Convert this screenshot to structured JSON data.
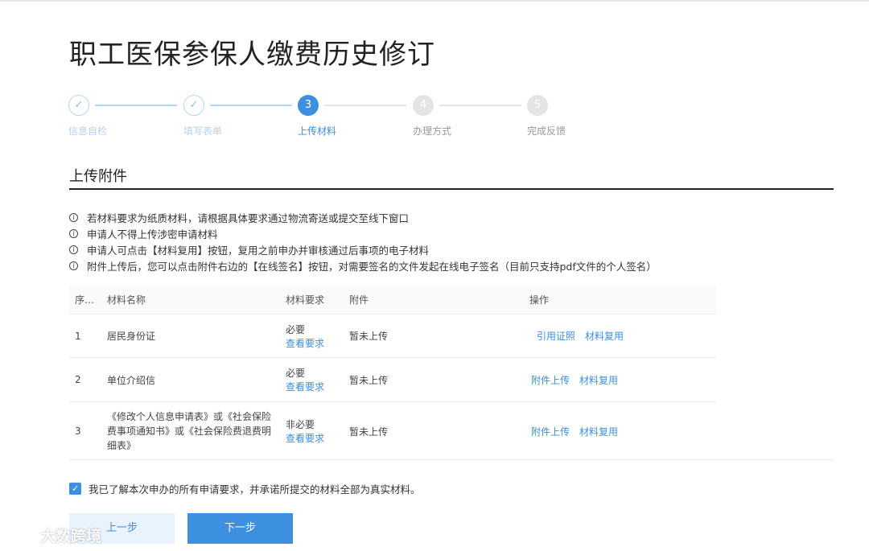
{
  "page": {
    "title": "职工医保参保人缴费历史修订"
  },
  "steps": [
    {
      "number": "✓",
      "label": "信息自检",
      "state": "done"
    },
    {
      "number": "✓",
      "label": "填写表单",
      "state": "done"
    },
    {
      "number": "3",
      "label": "上传材料",
      "state": "current"
    },
    {
      "number": "4",
      "label": "办理方式",
      "state": "todo"
    },
    {
      "number": "5",
      "label": "完成反馈",
      "state": "todo"
    }
  ],
  "section": {
    "title": "上传附件"
  },
  "notes": [
    "若材料要求为纸质材料，请根据具体要求通过物流寄送或提交至线下窗口",
    "申请人不得上传涉密申请材料",
    "申请人可点击【材料复用】按钮，复用之前申办并审核通过后事项的电子材料",
    "附件上传后，您可以点击附件右边的【在线签名】按钮，对需要签名的文件发起在线电子签名（目前只支持pdf文件的个人签名）"
  ],
  "table": {
    "headers": {
      "no": "序…",
      "name": "材料名称",
      "req": "材料要求",
      "att": "附件",
      "op": "操作"
    },
    "rows": [
      {
        "no": "1",
        "name": "居民身份证",
        "req": "必要",
        "req_link": "查看要求",
        "att": "暂未上传",
        "op1": "引用证照",
        "op2": "材料复用"
      },
      {
        "no": "2",
        "name": "单位介绍信",
        "req": "必要",
        "req_link": "查看要求",
        "att": "暂未上传",
        "op1": "附件上传",
        "op2": "材料复用"
      },
      {
        "no": "3",
        "name_lines": [
          "《修改个人信息申请表》或《社会保险",
          "费事项通知书》或《社会保险费退费明",
          "细表》"
        ],
        "req": "非必要",
        "req_link": "查看要求",
        "att": "暂未上传",
        "op1": "附件上传",
        "op2": "材料复用"
      }
    ]
  },
  "agreement": {
    "checked": true,
    "text": "我已了解本次申办的所有申请要求，并承诺所提交的材料全部为真实材料。"
  },
  "buttons": {
    "prev": "上一步",
    "next": "下一步"
  },
  "watermark": {
    "text": "大数跨境"
  },
  "colors": {
    "accent": "#3d8fe0",
    "done": "#b7d6f4",
    "todo": "#e4e4e4"
  }
}
